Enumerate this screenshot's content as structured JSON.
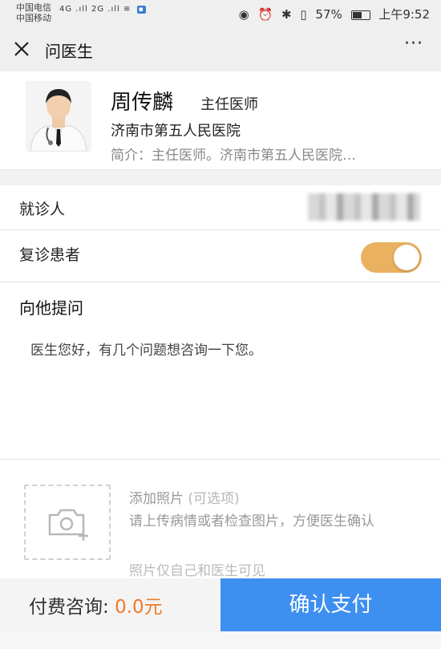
{
  "status_bar": {
    "carrier_1": "中国电信",
    "carrier_2": "中国移动",
    "network": "4G .ıll 2G .ıll",
    "battery": "57%",
    "time": "上午9:52"
  },
  "nav": {
    "title": "问医生",
    "more": "···"
  },
  "doctor": {
    "name": "周传麟",
    "title": "主任医师",
    "hospital": "济南市第五人民医院",
    "intro": "简介：主任医师。济南市第五人民医院…"
  },
  "form": {
    "patient_label": "就诊人",
    "followup_label": "复诊患者",
    "followup_on": true,
    "question_title": "向他提问",
    "question_text": "医生您好，有几个问题想咨询一下您。"
  },
  "photo": {
    "title": "添加照片",
    "optional": "(可选项)",
    "desc": "请上传病情或者检查图片，方便医生确认",
    "note": "照片仅自己和医生可见"
  },
  "footer": {
    "fee_label": "付费咨询:",
    "fee_value": "0.0元",
    "confirm": "确认支付"
  },
  "colors": {
    "toggle": "#eab160",
    "confirm": "#3d8ff0",
    "fee": "#f07a28"
  }
}
